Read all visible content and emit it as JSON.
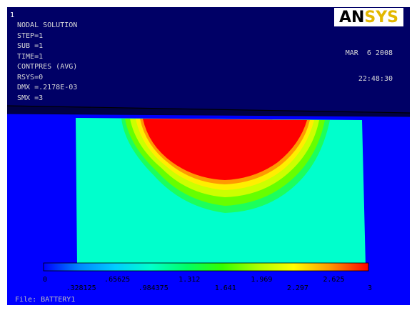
{
  "window_number": "1",
  "logo": {
    "part1": "AN",
    "part2": "SYS"
  },
  "info_lines": [
    "NODAL SOLUTION",
    "STEP=1",
    "SUB =1",
    "TIME=1",
    "CONTPRES (AVG)",
    "RSYS=0",
    "DMX =.2178E-03",
    "SMX =3"
  ],
  "date": "MAR  6 2008",
  "time": "22:48:30",
  "legend": {
    "top_labels": [
      "0",
      ".65625",
      "1.312",
      "1.969",
      "2.625"
    ],
    "bottom_labels": [
      ".328125",
      ".984375",
      "1.641",
      "2.297",
      "3"
    ],
    "min": 0,
    "max": 3,
    "colors": [
      "#0000ff",
      "#0088ff",
      "#00ccff",
      "#00ffcc",
      "#00ff66",
      "#33ff00",
      "#aaff00",
      "#ffff00",
      "#ff9900",
      "#ff0000"
    ]
  },
  "file_label": "File: BATTERY1",
  "colors": {
    "background": "#000066",
    "frame": "#ffffff"
  }
}
